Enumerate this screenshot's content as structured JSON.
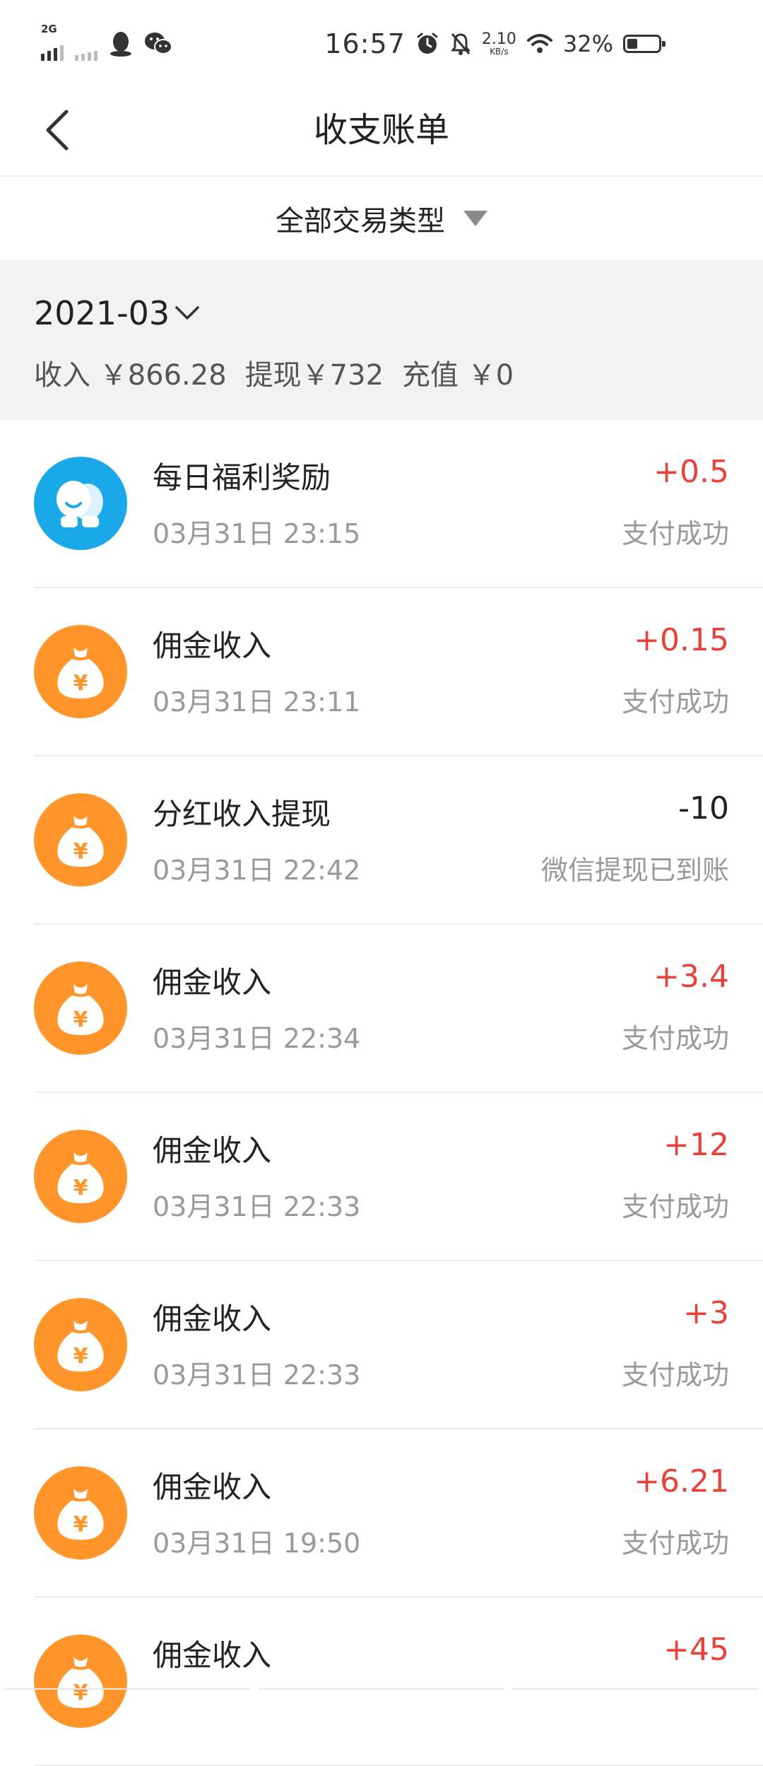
{
  "status_bar": {
    "network": "2G",
    "time": "16:57",
    "speed_value": "2.10",
    "speed_unit": "KB/s",
    "battery_text": "32%",
    "battery_level": 0.32
  },
  "header": {
    "title": "收支账单"
  },
  "filter": {
    "label": "全部交易类型"
  },
  "summary": {
    "month": "2021-03",
    "income": "收入 ￥866.28",
    "withdraw": "提现￥732",
    "recharge": "充值 ￥0"
  },
  "transactions": [
    {
      "title": "每日福利奖励",
      "time": "03月31日 23:15",
      "amount": "+0.5",
      "status": "支付成功",
      "icon": "welfare-icon"
    },
    {
      "title": "佣金收入",
      "time": "03月31日 23:11",
      "amount": "+0.15",
      "status": "支付成功",
      "icon": "money-bag-icon"
    },
    {
      "title": "分红收入提现",
      "time": "03月31日 22:42",
      "amount": "-10",
      "status": "微信提现已到账",
      "icon": "money-bag-icon"
    },
    {
      "title": "佣金收入",
      "time": "03月31日 22:34",
      "amount": "+3.4",
      "status": "支付成功",
      "icon": "money-bag-icon"
    },
    {
      "title": "佣金收入",
      "time": "03月31日 22:33",
      "amount": "+12",
      "status": "支付成功",
      "icon": "money-bag-icon"
    },
    {
      "title": "佣金收入",
      "time": "03月31日 22:33",
      "amount": "+3",
      "status": "支付成功",
      "icon": "money-bag-icon"
    },
    {
      "title": "佣金收入",
      "time": "03月31日 19:50",
      "amount": "+6.21",
      "status": "支付成功",
      "icon": "money-bag-icon"
    },
    {
      "title": "佣金收入",
      "time": "",
      "amount": "+45",
      "status": "",
      "icon": "money-bag-icon"
    }
  ],
  "colors": {
    "positive_amount": "#e8413a",
    "icon_orange": "#ff952b",
    "icon_blue": "#1aa8ea"
  }
}
